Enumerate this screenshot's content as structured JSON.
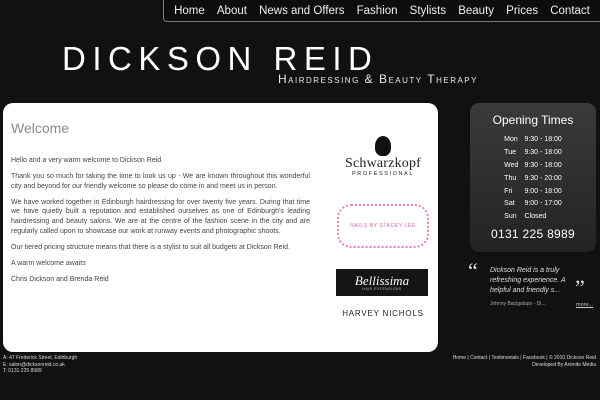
{
  "nav": {
    "items": [
      "Home",
      "About",
      "News and Offers",
      "Fashion",
      "Stylists",
      "Beauty",
      "Prices",
      "Contact"
    ]
  },
  "logo": {
    "title": "DICKSON REID",
    "subtitle": "Hairdressing & Beauty Therapy"
  },
  "content": {
    "heading": "Welcome",
    "paragraphs": [
      "Hello and a very warm welcome to Dickson Reid",
      "Thank you so much for taking the time to look us up - We are known throughout this wonderful city and beyond for our friendly welcome so please do come in and meet us in person.",
      "We have worked together in Edinburgh hairdressing for over twenty five years. During that time we have quietly built a reputation and established ourselves as one of Edinburgh's leading hairdressing and beauty salons. We are at the centre of the fashion scene in the city and are regularly called upon to showcase our work at runway events and photographic shoots.",
      "Our tiered pricing structure means that there is a stylist to suit all budgets at Dickson Reid.",
      "A warm welcome awaits",
      "Chris Dickson and Brenda Reid"
    ]
  },
  "brands": {
    "schwarzkopf": "Schwarzkopf",
    "schwarzkopf_sub": "PROFESSIONAL",
    "nails": "NAILS BY STACEY-LEE",
    "bellissima": "Bellissima",
    "bellissima_sub": "HAIR EXTENSIONS",
    "harvey": "HARVEY NICHOLS"
  },
  "hours": {
    "title": "Opening Times",
    "rows": [
      {
        "day": "Mon",
        "time": "9:30 - 18:00"
      },
      {
        "day": "Tue",
        "time": "9:30 - 18:00"
      },
      {
        "day": "Wed",
        "time": "9:30 - 18:00"
      },
      {
        "day": "Thu",
        "time": "9:30 - 20:00"
      },
      {
        "day": "Fri",
        "time": "9:00 - 18:00"
      },
      {
        "day": "Sat",
        "time": "9:00 - 17:00"
      },
      {
        "day": "Sun",
        "time": "Closed"
      }
    ],
    "phone": "0131 225 8989"
  },
  "testimonial": {
    "text": "Dickson Reid is a truly refreshing experience. A helpful and friendly s...",
    "author": "Johnny Bacigalupo - Di...",
    "more": "more..."
  },
  "footer": {
    "address": "A: 47 Frederick Street, Edinburgh",
    "email": "E: salon@dicksonreid.co.uk",
    "phone": "T: 0131 225 8989",
    "links": [
      "Home",
      "Contact",
      "Testimonials",
      "Facebook"
    ],
    "copyright": "© 2010 Dickson Reid",
    "developed": "Developed By Animite Media"
  }
}
